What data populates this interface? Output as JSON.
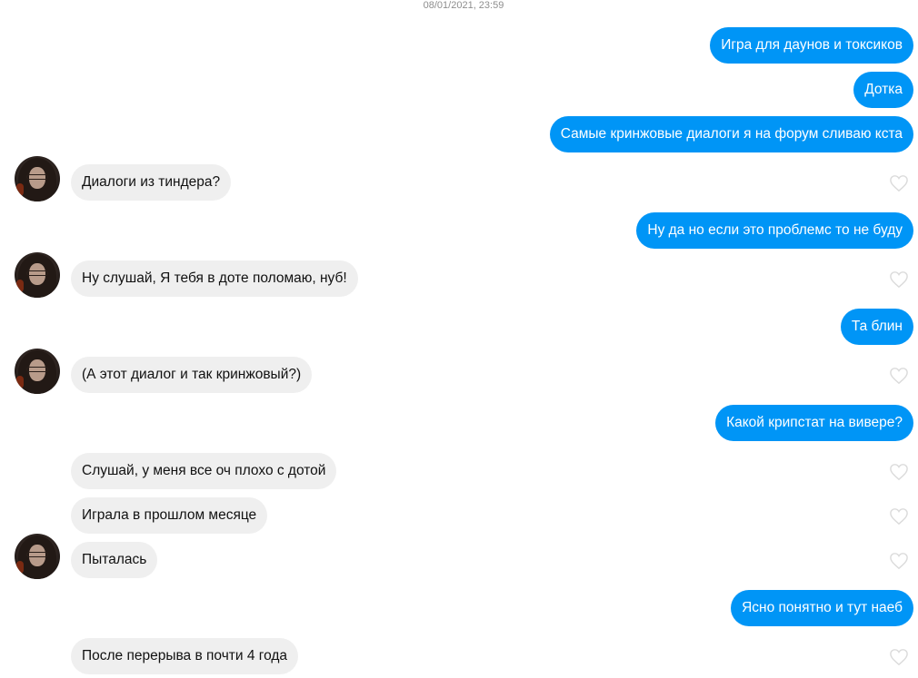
{
  "timestamp": "08/01/2021, 23:59",
  "messages": [
    {
      "dir": "out",
      "text": "Игра для даунов и токсиков"
    },
    {
      "dir": "out",
      "text": "Дотка"
    },
    {
      "dir": "out",
      "text": "Самые кринжовые диалоги я на форум сливаю кста"
    },
    {
      "dir": "in",
      "text": "Диалоги из тиндера?",
      "avatar": true
    },
    {
      "dir": "out",
      "text": "Ну да но если это проблемс то не буду"
    },
    {
      "dir": "in",
      "text": "Ну слушай, Я тебя в доте поломаю, нуб!",
      "avatar": true
    },
    {
      "dir": "out",
      "text": "Та блин"
    },
    {
      "dir": "in",
      "text": "(А этот диалог и так кринжовый?)",
      "avatar": true
    },
    {
      "dir": "out",
      "text": "Какой крипстат на вивере?"
    },
    {
      "dir": "in",
      "text": "Слушай, у меня все оч плохо с дотой"
    },
    {
      "dir": "in",
      "text": "Играла в прошлом месяце"
    },
    {
      "dir": "in",
      "text": "Пыталась",
      "avatar": true
    },
    {
      "dir": "out",
      "text": "Ясно понятно и тут наеб"
    },
    {
      "dir": "in",
      "text": "После перерыва в почти 4 года"
    }
  ]
}
